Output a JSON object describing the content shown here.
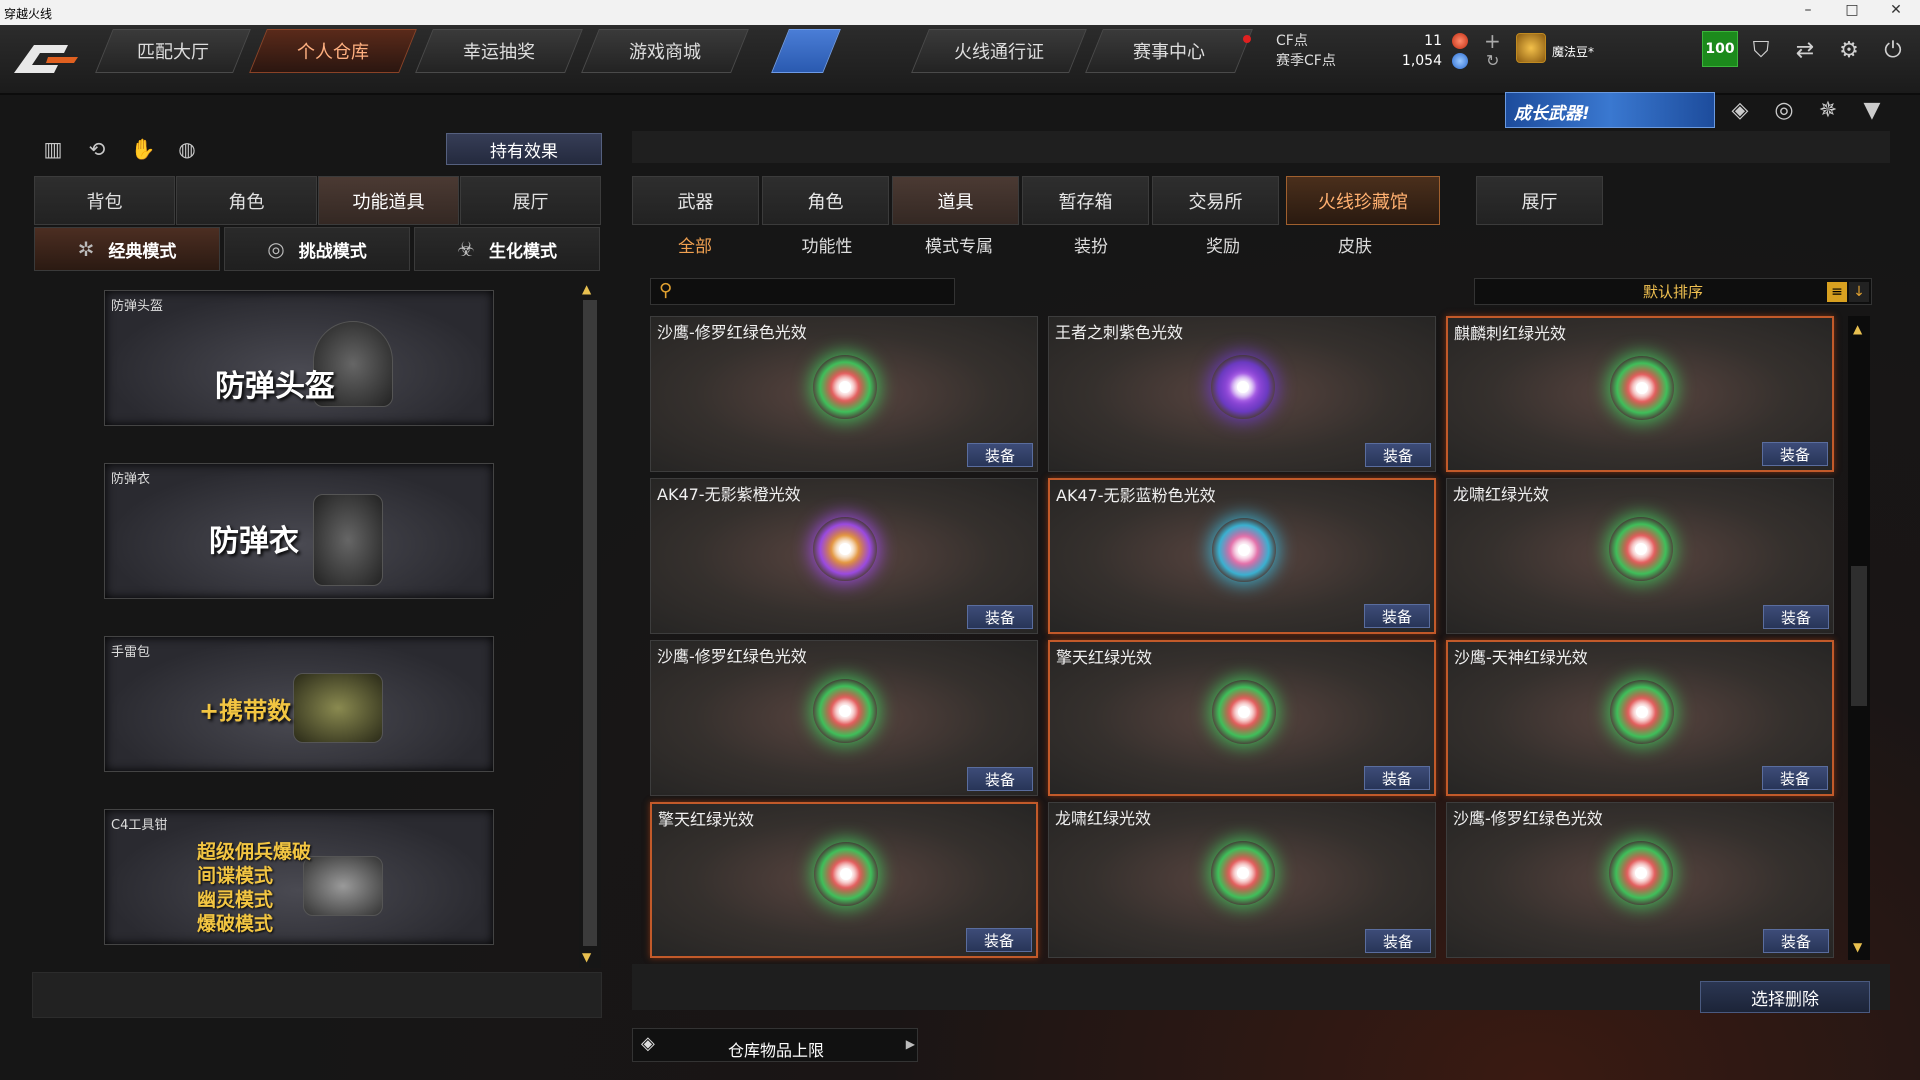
{
  "window": {
    "title": "穿越火线"
  },
  "nav": {
    "tabs": [
      {
        "label": "匹配大厅"
      },
      {
        "label": "个人仓库"
      },
      {
        "label": "幸运抽奖"
      },
      {
        "label": "游戏商城"
      },
      {
        "label": ""
      },
      {
        "label": "火线通行证"
      },
      {
        "label": "赛事中心"
      }
    ],
    "active_tab": "个人仓库"
  },
  "currency": {
    "cf_label": "CF点",
    "cf_value": "11",
    "season_label": "赛季CF点",
    "season_value": "1,054"
  },
  "user": {
    "name": "魔法豆*",
    "level": "100"
  },
  "banner": {
    "growth_label": "成长武器!"
  },
  "left": {
    "effect_button": "持有效果",
    "tabs": [
      "背包",
      "角色",
      "功能道具",
      "展厅"
    ],
    "active_tab": "功能道具",
    "modes": [
      {
        "label": "经典模式",
        "icon": "star-icon"
      },
      {
        "label": "挑战模式",
        "icon": "heartbeat-icon"
      },
      {
        "label": "生化模式",
        "icon": "biohazard-icon"
      }
    ],
    "items": [
      {
        "caption": "防弹头盔",
        "big": "防弹头盔"
      },
      {
        "caption": "防弹衣",
        "big": "防弹衣"
      },
      {
        "caption": "手雷包",
        "big": "+携带数"
      },
      {
        "caption": "C4工具钳",
        "lines": [
          "超级佣兵爆破",
          "间谍模式",
          "幽灵模式",
          "爆破模式"
        ]
      }
    ]
  },
  "right": {
    "tabs": [
      "武器",
      "角色",
      "道具",
      "暂存箱",
      "交易所",
      "火线珍藏馆",
      "展厅"
    ],
    "active_tab": "道具",
    "subtabs": [
      "全部",
      "功能性",
      "模式专属",
      "装扮",
      "奖励",
      "皮肤"
    ],
    "active_subtab": "全部",
    "search_placeholder": "",
    "sort_label": "默认排序",
    "equip_label": "装备",
    "items": [
      {
        "name": "沙鹰-修罗红绿色光效",
        "color": "#e04a4a",
        "color2": "#3fbf5a",
        "selected": false
      },
      {
        "name": "王者之刺紫色光效",
        "color": "#9a4ae0",
        "color2": "#6a3ac0",
        "selected": false
      },
      {
        "name": "麒麟刺红绿光效",
        "color": "#e04a4a",
        "color2": "#3fbf5a",
        "selected": true
      },
      {
        "name": "AK47-无影紫橙光效",
        "color": "#e08a2a",
        "color2": "#9a4ae0",
        "selected": false
      },
      {
        "name": "AK47-无影蓝粉色光效",
        "color": "#e060a0",
        "color2": "#3ab0d0",
        "selected": true
      },
      {
        "name": "龙啸红绿光效",
        "color": "#e04a4a",
        "color2": "#3fbf5a",
        "selected": false
      },
      {
        "name": "沙鹰-修罗红绿色光效",
        "color": "#e04a4a",
        "color2": "#3fbf5a",
        "selected": false
      },
      {
        "name": "擎天红绿光效",
        "color": "#e04a4a",
        "color2": "#3fbf5a",
        "selected": true
      },
      {
        "name": "沙鹰-天神红绿光效",
        "color": "#e04a4a",
        "color2": "#3fbf5a",
        "selected": true
      },
      {
        "name": "擎天红绿光效",
        "color": "#e04a4a",
        "color2": "#3fbf5a",
        "selected": true
      },
      {
        "name": "龙啸红绿光效",
        "color": "#e04a4a",
        "color2": "#3fbf5a",
        "selected": false
      },
      {
        "name": "沙鹰-修罗红绿色光效",
        "color": "#e04a4a",
        "color2": "#3fbf5a",
        "selected": false
      }
    ],
    "delete_button": "选择删除",
    "storage_limit_label": "仓库物品上限"
  }
}
